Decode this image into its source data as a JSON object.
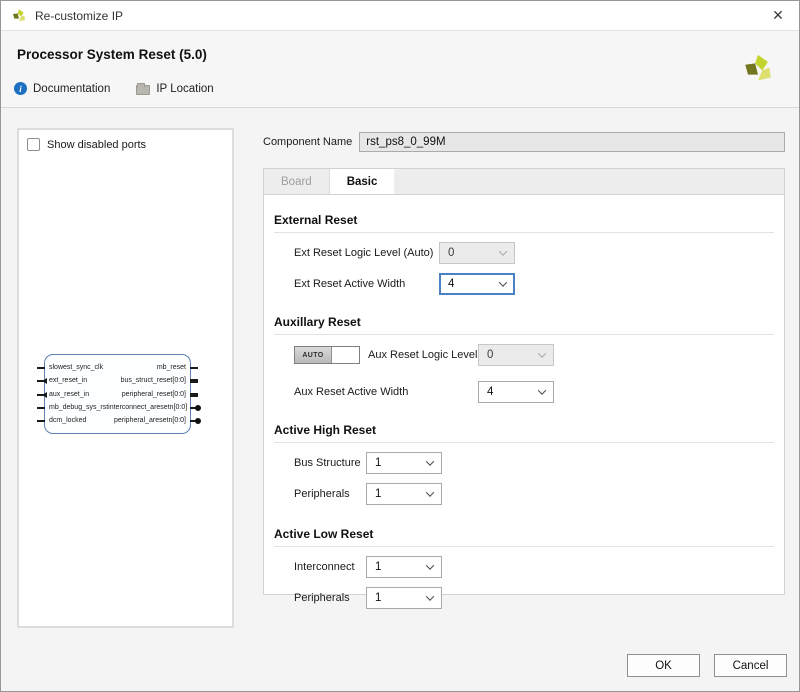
{
  "window": {
    "title": "Re-customize IP",
    "close_glyph": "✕"
  },
  "header": {
    "title": "Processor System Reset (5.0)",
    "toolbar": [
      {
        "icon": "info-icon",
        "label": "Documentation"
      },
      {
        "icon": "folder-icon",
        "label": "IP Location"
      }
    ]
  },
  "left_panel": {
    "show_ports_label": "Show disabled ports",
    "show_ports_checked": false
  },
  "ports": {
    "left": [
      {
        "name": "slowest_sync_clk",
        "marker": "line"
      },
      {
        "name": "ext_reset_in",
        "marker": "arrow"
      },
      {
        "name": "aux_reset_in",
        "marker": "arrow"
      },
      {
        "name": "mb_debug_sys_rst",
        "marker": "line"
      },
      {
        "name": "dcm_locked",
        "marker": "line"
      }
    ],
    "right": [
      {
        "name": "mb_reset",
        "marker": "line"
      },
      {
        "name": "bus_struct_reset[0:0]",
        "marker": "bus"
      },
      {
        "name": "peripheral_reset[0:0]",
        "marker": "bus"
      },
      {
        "name": "interconnect_aresetn[0:0]",
        "marker": "circle"
      },
      {
        "name": "peripheral_aresetn[0:0]",
        "marker": "circle"
      }
    ]
  },
  "component": {
    "label": "Component Name",
    "value": "rst_ps8_0_99M"
  },
  "tabs": [
    {
      "label": "Board",
      "state": "disabled"
    },
    {
      "label": "Basic",
      "state": "active"
    }
  ],
  "sections": [
    {
      "title": "External Reset",
      "rows": [
        {
          "label": "Ext Reset Logic Level (Auto)",
          "value": "0",
          "state": "disabled"
        },
        {
          "label": "Ext Reset Active Width",
          "value": "4",
          "state": "focused"
        }
      ]
    },
    {
      "title": "Auxillary Reset",
      "toggle_label": "AUTO",
      "rows": [
        {
          "label": "Aux Reset Logic Level",
          "value": "0",
          "state": "disabled"
        },
        {
          "label": "Aux Reset Active Width",
          "value": "4",
          "state": "normal"
        }
      ]
    },
    {
      "title": "Active High Reset",
      "rows": [
        {
          "label": "Bus Structure",
          "value": "1",
          "state": "normal"
        },
        {
          "label": "Peripherals",
          "value": "1",
          "state": "normal"
        }
      ]
    },
    {
      "title": "Active Low Reset",
      "rows": [
        {
          "label": "Interconnect",
          "value": "1",
          "state": "normal"
        },
        {
          "label": "Peripherals",
          "value": "1",
          "state": "normal"
        }
      ]
    }
  ],
  "footer": {
    "ok_label": "OK",
    "cancel_label": "Cancel"
  },
  "colors": {
    "focus_blue": "#4a80c4",
    "info_blue": "#1d70c0",
    "block_border": "#5e81b5",
    "logo_bright": "#c3d52c",
    "logo_dark": "#72761f",
    "logo_pale": "#dde06e"
  }
}
